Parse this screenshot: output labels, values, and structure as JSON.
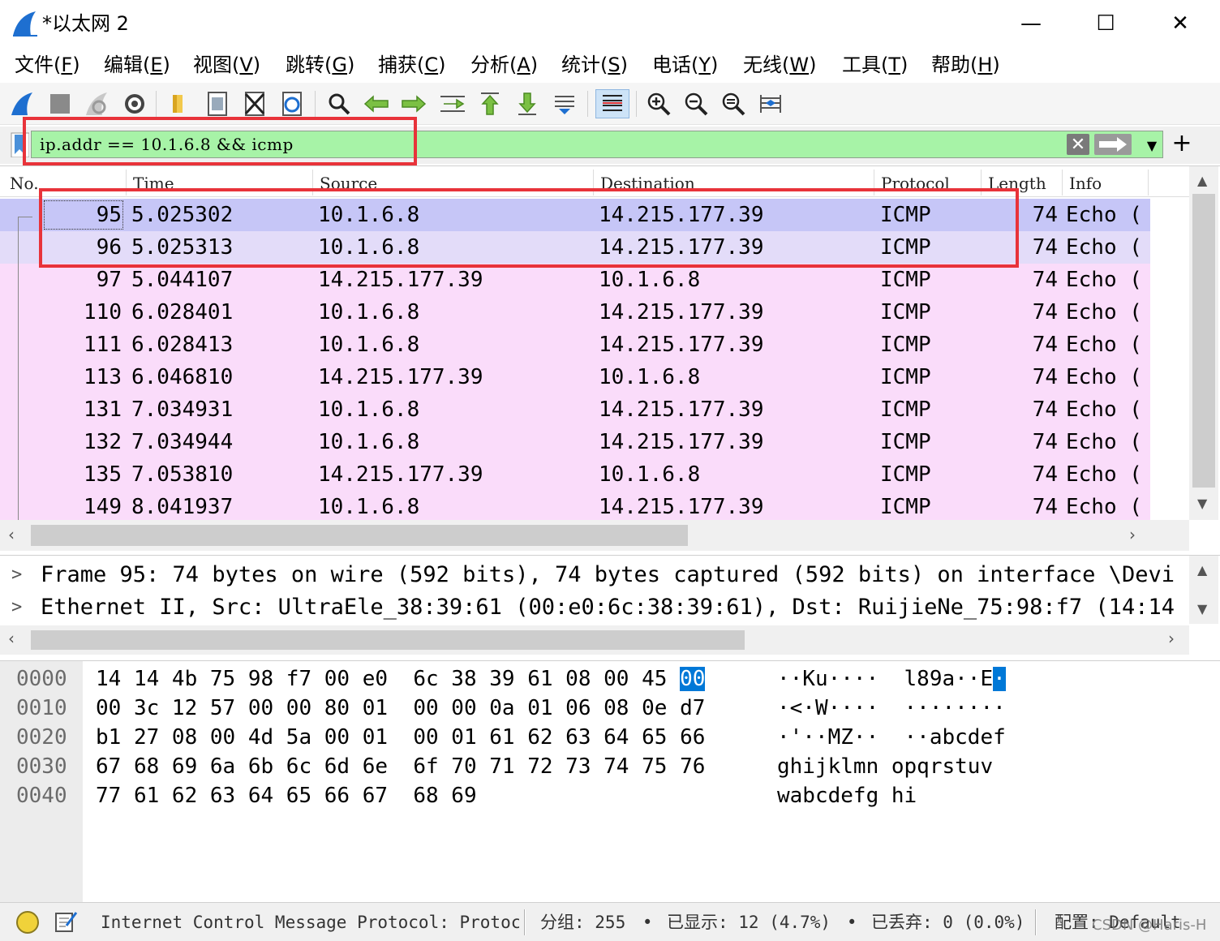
{
  "window": {
    "title": "*以太网 2",
    "minimize": "—",
    "maximize": "☐",
    "close": "✕"
  },
  "menu": [
    {
      "label": "文件(",
      "key": "F",
      "end": ")"
    },
    {
      "label": "编辑(",
      "key": "E",
      "end": ")"
    },
    {
      "label": "视图(",
      "key": "V",
      "end": ")"
    },
    {
      "label": "跳转(",
      "key": "G",
      "end": ")"
    },
    {
      "label": "捕获(",
      "key": "C",
      "end": ")"
    },
    {
      "label": "分析(",
      "key": "A",
      "end": ")"
    },
    {
      "label": "统计(",
      "key": "S",
      "end": ")"
    },
    {
      "label": "电话(",
      "key": "Y",
      "end": ")"
    },
    {
      "label": "无线(",
      "key": "W",
      "end": ")"
    },
    {
      "label": "工具(",
      "key": "T",
      "end": ")"
    },
    {
      "label": "帮助(",
      "key": "H",
      "end": ")"
    }
  ],
  "filter": {
    "value": "ip.addr == 10.1.6.8 && icmp",
    "clear_icon": "✕",
    "dropdown_icon": "▼",
    "add_icon": "+"
  },
  "packet_list": {
    "columns": [
      "No.",
      "Time",
      "Source",
      "Destination",
      "Protocol",
      "Length",
      "Info"
    ],
    "rows": [
      {
        "no": "95",
        "time": "5.025302",
        "src": "10.1.6.8",
        "dst": "14.215.177.39",
        "proto": "ICMP",
        "len": "74",
        "info": "Echo (",
        "state": "sel"
      },
      {
        "no": "96",
        "time": "5.025313",
        "src": "10.1.6.8",
        "dst": "14.215.177.39",
        "proto": "ICMP",
        "len": "74",
        "info": "Echo (",
        "state": "sel2"
      },
      {
        "no": "97",
        "time": "5.044107",
        "src": "14.215.177.39",
        "dst": "10.1.6.8",
        "proto": "ICMP",
        "len": "74",
        "info": "Echo (",
        "state": "norm"
      },
      {
        "no": "110",
        "time": "6.028401",
        "src": "10.1.6.8",
        "dst": "14.215.177.39",
        "proto": "ICMP",
        "len": "74",
        "info": "Echo (",
        "state": "norm"
      },
      {
        "no": "111",
        "time": "6.028413",
        "src": "10.1.6.8",
        "dst": "14.215.177.39",
        "proto": "ICMP",
        "len": "74",
        "info": "Echo (",
        "state": "norm"
      },
      {
        "no": "113",
        "time": "6.046810",
        "src": "14.215.177.39",
        "dst": "10.1.6.8",
        "proto": "ICMP",
        "len": "74",
        "info": "Echo (",
        "state": "norm"
      },
      {
        "no": "131",
        "time": "7.034931",
        "src": "10.1.6.8",
        "dst": "14.215.177.39",
        "proto": "ICMP",
        "len": "74",
        "info": "Echo (",
        "state": "norm"
      },
      {
        "no": "132",
        "time": "7.034944",
        "src": "10.1.6.8",
        "dst": "14.215.177.39",
        "proto": "ICMP",
        "len": "74",
        "info": "Echo (",
        "state": "norm"
      },
      {
        "no": "135",
        "time": "7.053810",
        "src": "14.215.177.39",
        "dst": "10.1.6.8",
        "proto": "ICMP",
        "len": "74",
        "info": "Echo (",
        "state": "norm"
      },
      {
        "no": "149",
        "time": "8.041937",
        "src": "10.1.6.8",
        "dst": "14.215.177.39",
        "proto": "ICMP",
        "len": "74",
        "info": "Echo (",
        "state": "norm"
      }
    ]
  },
  "details": [
    {
      "arrow": ">",
      "text": "Frame 95: 74 bytes on wire (592 bits), 74 bytes captured (592 bits) on interface \\Devi"
    },
    {
      "arrow": ">",
      "text": "Ethernet II, Src: UltraEle_38:39:61 (00:e0:6c:38:39:61), Dst: RuijieNe_75:98:f7 (14:14"
    }
  ],
  "bytes": [
    {
      "offset": "0000",
      "hex_a": "14 14 4b 75 98 f7 00 e0",
      "hex_b": "6c 38 39 61 08 00 45",
      "hex_hl": "00",
      "ascii_a": "··Ku····  l89a··E",
      "ascii_hl": "·"
    },
    {
      "offset": "0010",
      "hex_a": "00 3c 12 57 00 00 80 01",
      "hex_b": "00 00 0a 01 06 08 0e d7",
      "hex_hl": "",
      "ascii_a": "·<·W····  ········",
      "ascii_hl": ""
    },
    {
      "offset": "0020",
      "hex_a": "b1 27 08 00 4d 5a 00 01",
      "hex_b": "00 01 61 62 63 64 65 66",
      "hex_hl": "",
      "ascii_a": "·'··MZ··  ··abcdef",
      "ascii_hl": ""
    },
    {
      "offset": "0030",
      "hex_a": "67 68 69 6a 6b 6c 6d 6e",
      "hex_b": "6f 70 71 72 73 74 75 76",
      "hex_hl": "",
      "ascii_a": "ghijklmn opqrstuv",
      "ascii_hl": ""
    },
    {
      "offset": "0040",
      "hex_a": "77 61 62 63 64 65 66 67",
      "hex_b": "68 69",
      "hex_hl": "",
      "ascii_a": "wabcdefg hi",
      "ascii_hl": ""
    }
  ],
  "status": {
    "protocol_text": "Internet Control Message Protocol: Protocol",
    "packets": "分组: 255",
    "displayed": "已显示: 12 (4.7%)",
    "dropped": "已丢弃: 0 (0.0%)",
    "profile": "配置: Default",
    "bullet": "•",
    "watermark": "CSDN @Haris-H"
  },
  "colors": {
    "filter_bg": "#a7f3a7",
    "row_selected": "#c6c6f7",
    "row_icmp": "#fadcfa",
    "annotation": "#e8333a"
  }
}
